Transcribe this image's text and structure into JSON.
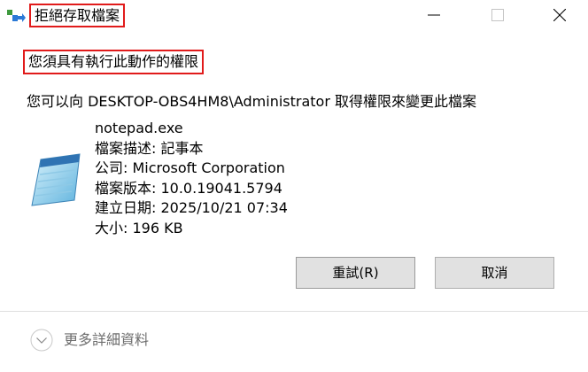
{
  "titlebar": {
    "icon": "copy-permission-icon",
    "title": "拒絕存取檔案",
    "minimize_icon": "minimize-icon",
    "maximize_icon": "maximize-icon",
    "close_icon": "close-icon"
  },
  "heading": "您須具有執行此動作的權限",
  "message": "您可以向 DESKTOP-OBS4HM8\\Administrator 取得權限來變更此檔案",
  "file": {
    "icon": "notepad-file-icon",
    "name": "notepad.exe",
    "description": "檔案描述: 記事本",
    "company": "公司: Microsoft Corporation",
    "version": "檔案版本: 10.0.19041.5794",
    "created": "建立日期: 2025/10/21 07:34",
    "size": "大小: 196 KB"
  },
  "buttons": {
    "retry": "重試(R)",
    "cancel": "取消"
  },
  "footer": {
    "details_icon": "chevron-down-circle-icon",
    "details_label": "更多詳細資料"
  },
  "colors": {
    "highlight_border": "#e11b1b",
    "button_bg": "#e1e1e1",
    "details_text": "#6d6d6d"
  }
}
